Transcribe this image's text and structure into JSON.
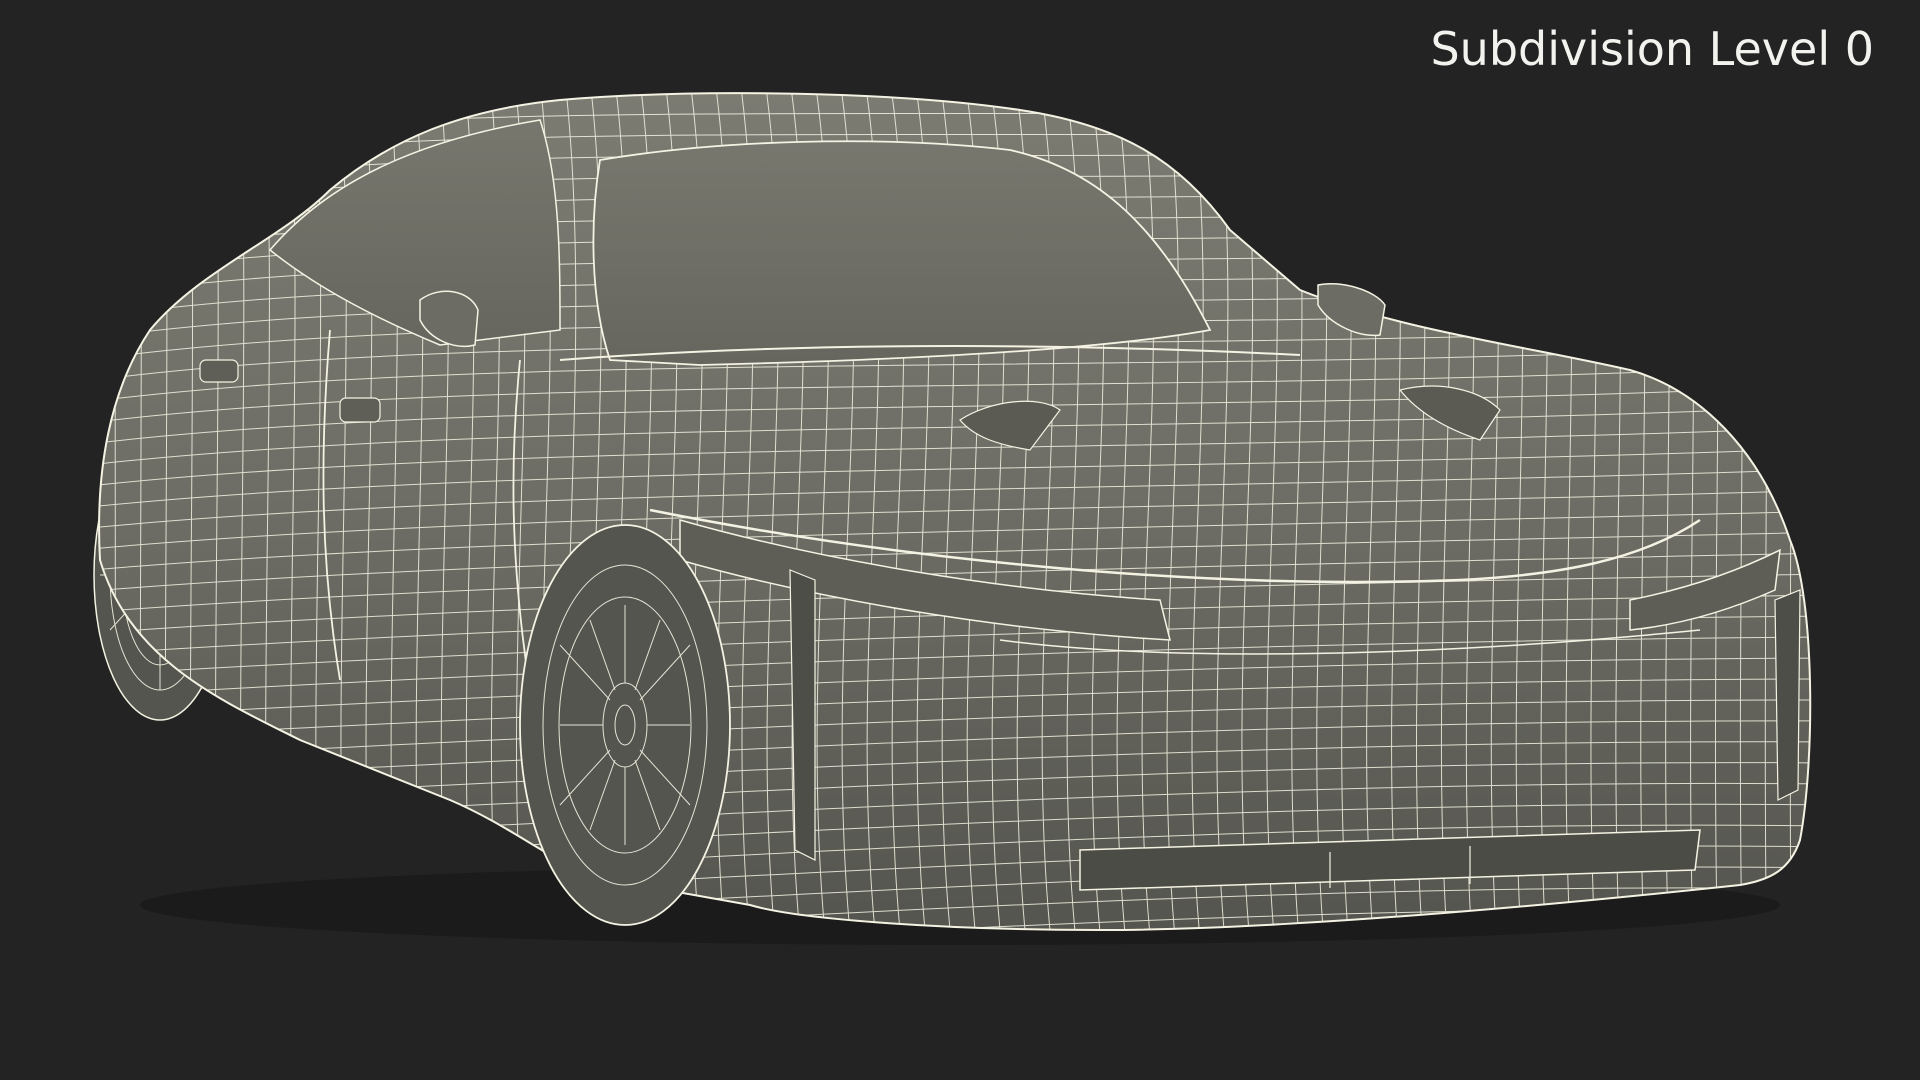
{
  "viewport": {
    "background": "#232323",
    "label": "Subdivision Level 0"
  },
  "model": {
    "surface_color": "#6f6f68",
    "wire_color": "#f4f3e3",
    "shadow_color": "#4a4a44"
  }
}
